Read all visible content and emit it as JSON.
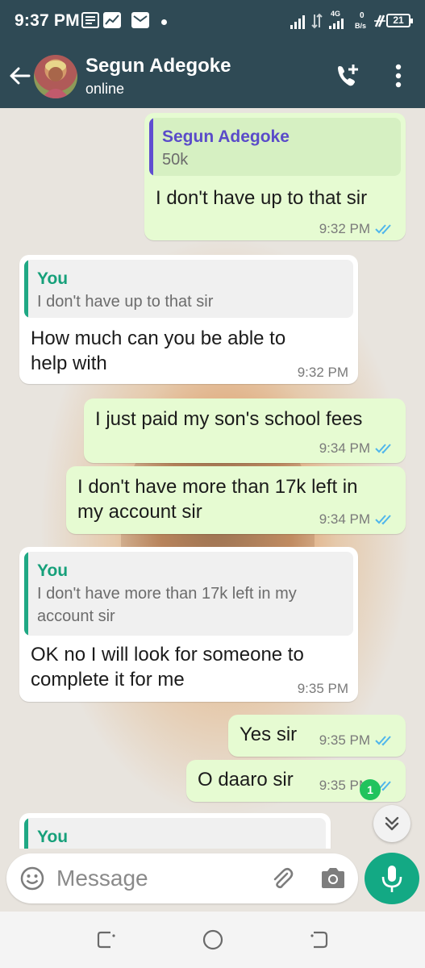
{
  "status_bar": {
    "time": "9:37 PM",
    "network_type": "4G",
    "data_rate_value": "0",
    "data_rate_unit": "B/s",
    "battery": "21",
    "icons": [
      "message-icon",
      "chart-icon",
      "mail-icon",
      "dot-icon",
      "signal-icon",
      "signal-4g-icon",
      "wifi-calling-icon",
      "battery-icon"
    ]
  },
  "header": {
    "contact_name": "Segun Adegoke",
    "status": "online",
    "icons": [
      "back-arrow-icon",
      "avatar",
      "add-call-icon",
      "more-vert-icon"
    ]
  },
  "messages": [
    {
      "direction": "out",
      "quote_author": "Segun Adegoke",
      "quote_text": [
        "50k"
      ],
      "lines": [
        "I don't have up to that sir"
      ],
      "time": "9:32 PM",
      "read": true
    },
    {
      "direction": "in",
      "quote_author": "You",
      "quote_text": [
        "I don't have up to that sir"
      ],
      "lines": [
        "How much can you be able to",
        "help with"
      ],
      "time": "9:32 PM"
    },
    {
      "direction": "out",
      "lines": [
        "I just paid my son's school fees"
      ],
      "time": "9:34 PM",
      "read": true
    },
    {
      "direction": "out",
      "lines": [
        "I don't have more than 17k left in",
        "my account sir"
      ],
      "time": "9:34 PM",
      "read": true
    },
    {
      "direction": "in",
      "quote_author": "You",
      "quote_text": [
        "I don't have more than 17k left in my",
        "account sir"
      ],
      "lines": [
        "OK no I will look for someone to",
        "complete it for me"
      ],
      "time": "9:35 PM"
    },
    {
      "direction": "out",
      "lines": [
        "Yes sir"
      ],
      "time": "9:35 PM",
      "read": true
    },
    {
      "direction": "out",
      "lines": [
        "O daaro sir"
      ],
      "time": "9:35 PM",
      "read": true
    },
    {
      "direction": "in",
      "quote_author": "You",
      "partial": true
    }
  ],
  "unread_count": "1",
  "composer": {
    "placeholder": "Message",
    "icons": [
      "emoji-icon",
      "attach-icon",
      "camera-icon",
      "mic-icon"
    ]
  },
  "colors": {
    "header_bg": "#2f4a55",
    "outgoing_bubble": "#e6fbd2",
    "incoming_bubble": "#ffffff",
    "accent_green": "#13a984",
    "read_tick_blue": "#4fb6ec",
    "quote_bar_out": "#5f4ed0",
    "quote_bar_in": "#1fa884"
  },
  "nav_bar": {
    "icons": [
      "recents-icon",
      "home-icon",
      "back-nav-icon"
    ]
  }
}
